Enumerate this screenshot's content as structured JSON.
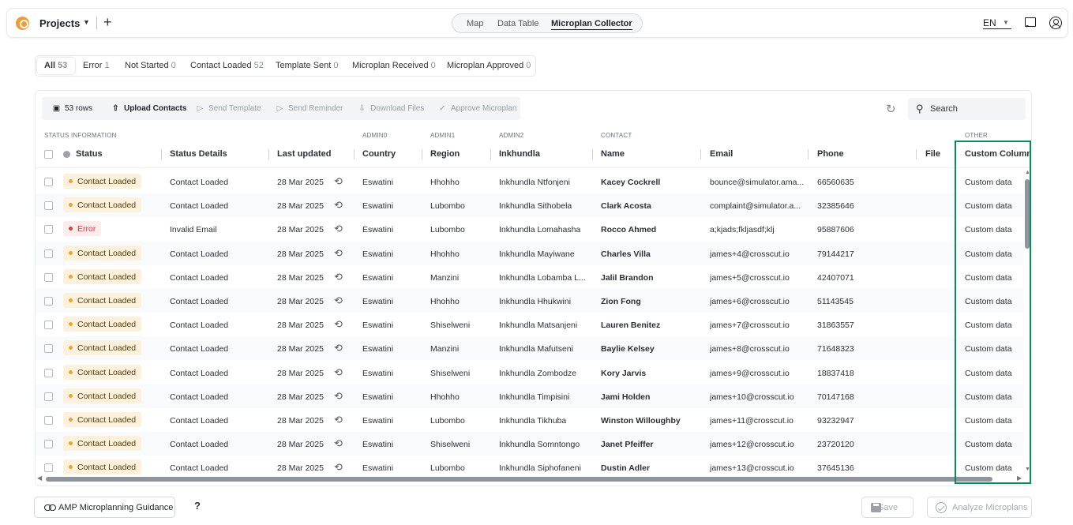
{
  "topbar": {
    "title": "Projects",
    "view_tabs": [
      "Map",
      "Data Table",
      "Microplan Collector"
    ],
    "active_tab": "Microplan Collector",
    "language": "EN"
  },
  "filters": [
    {
      "label": "All",
      "count": "53"
    },
    {
      "label": "Error",
      "count": "1"
    },
    {
      "label": "Not Started",
      "count": "0"
    },
    {
      "label": "Contact Loaded",
      "count": "52"
    },
    {
      "label": "Template Sent",
      "count": "0"
    },
    {
      "label": "Microplan Received",
      "count": "0"
    },
    {
      "label": "Microplan Approved",
      "count": "0"
    }
  ],
  "toolbar": {
    "rows_label": "53 rows",
    "upload": "Upload Contacts",
    "send_template": "Send Template",
    "send_reminder": "Send Reminder",
    "download_files": "Download Files",
    "approve_microplan": "Approve Microplan",
    "search_placeholder": "Search"
  },
  "groups": {
    "status": "STATUS INFORMATION",
    "admin0": "ADMIN0",
    "admin1": "ADMIN1",
    "admin2": "ADMIN2",
    "contact": "CONTACT",
    "other": "OTHER"
  },
  "columns": {
    "status": "Status",
    "status_details": "Status Details",
    "last_updated": "Last updated",
    "country": "Country",
    "region": "Region",
    "inkhundla": "Inkhundla",
    "name": "Name",
    "email": "Email",
    "phone": "Phone",
    "file": "File",
    "custom": "Custom Column"
  },
  "rows": [
    {
      "status": "Contact Loaded",
      "kind": "ok",
      "details": "Contact Loaded",
      "updated": "28 Mar 2025",
      "country": "Eswatini",
      "region": "Hhohho",
      "inkhundla": "Inkhundla Ntfonjeni",
      "name": "Kacey Cockrell",
      "email": "bounce@simulator.ama...",
      "phone": "66560635",
      "custom": "Custom data"
    },
    {
      "status": "Contact Loaded",
      "kind": "ok",
      "details": "Contact Loaded",
      "updated": "28 Mar 2025",
      "country": "Eswatini",
      "region": "Lubombo",
      "inkhundla": "Inkhundla Sithobela",
      "name": "Clark Acosta",
      "email": "complaint@simulator.a...",
      "phone": "32385646",
      "custom": "Custom data"
    },
    {
      "status": "Error",
      "kind": "err",
      "details": "Invalid Email",
      "updated": "28 Mar 2025",
      "country": "Eswatini",
      "region": "Lubombo",
      "inkhundla": "Inkhundla Lomahasha",
      "name": "Rocco Ahmed",
      "email": "a;kjads;fkljasdf;klj",
      "phone": "95887606",
      "custom": "Custom data"
    },
    {
      "status": "Contact Loaded",
      "kind": "ok",
      "details": "Contact Loaded",
      "updated": "28 Mar 2025",
      "country": "Eswatini",
      "region": "Hhohho",
      "inkhundla": "Inkhundla Mayiwane",
      "name": "Charles Villa",
      "email": "james+4@crosscut.io",
      "phone": "79144217",
      "custom": "Custom data"
    },
    {
      "status": "Contact Loaded",
      "kind": "ok",
      "details": "Contact Loaded",
      "updated": "28 Mar 2025",
      "country": "Eswatini",
      "region": "Manzini",
      "inkhundla": "Inkhundla Lobamba L...",
      "name": "Jalil Brandon",
      "email": "james+5@crosscut.io",
      "phone": "42407071",
      "custom": "Custom data"
    },
    {
      "status": "Contact Loaded",
      "kind": "ok",
      "details": "Contact Loaded",
      "updated": "28 Mar 2025",
      "country": "Eswatini",
      "region": "Hhohho",
      "inkhundla": "Inkhundla Hhukwini",
      "name": "Zion Fong",
      "email": "james+6@crosscut.io",
      "phone": "51143545",
      "custom": "Custom data"
    },
    {
      "status": "Contact Loaded",
      "kind": "ok",
      "details": "Contact Loaded",
      "updated": "28 Mar 2025",
      "country": "Eswatini",
      "region": "Shiselweni",
      "inkhundla": "Inkhundla Matsanjeni",
      "name": "Lauren Benitez",
      "email": "james+7@crosscut.io",
      "phone": "31863557",
      "custom": "Custom data"
    },
    {
      "status": "Contact Loaded",
      "kind": "ok",
      "details": "Contact Loaded",
      "updated": "28 Mar 2025",
      "country": "Eswatini",
      "region": "Manzini",
      "inkhundla": "Inkhundla Mafutseni",
      "name": "Baylie Kelsey",
      "email": "james+8@crosscut.io",
      "phone": "71648323",
      "custom": "Custom data"
    },
    {
      "status": "Contact Loaded",
      "kind": "ok",
      "details": "Contact Loaded",
      "updated": "28 Mar 2025",
      "country": "Eswatini",
      "region": "Shiselweni",
      "inkhundla": "Inkhundla Zombodze",
      "name": "Kory Jarvis",
      "email": "james+9@crosscut.io",
      "phone": "18837418",
      "custom": "Custom data"
    },
    {
      "status": "Contact Loaded",
      "kind": "ok",
      "details": "Contact Loaded",
      "updated": "28 Mar 2025",
      "country": "Eswatini",
      "region": "Hhohho",
      "inkhundla": "Inkhundla Timpisini",
      "name": "Jami Holden",
      "email": "james+10@crosscut.io",
      "phone": "70147168",
      "custom": "Custom data"
    },
    {
      "status": "Contact Loaded",
      "kind": "ok",
      "details": "Contact Loaded",
      "updated": "28 Mar 2025",
      "country": "Eswatini",
      "region": "Lubombo",
      "inkhundla": "Inkhundla Tikhuba",
      "name": "Winston Willoughby",
      "email": "james+11@crosscut.io",
      "phone": "93232947",
      "custom": "Custom data"
    },
    {
      "status": "Contact Loaded",
      "kind": "ok",
      "details": "Contact Loaded",
      "updated": "28 Mar 2025",
      "country": "Eswatini",
      "region": "Shiselweni",
      "inkhundla": "Inkhundla Somntongo",
      "name": "Janet Pfeiffer",
      "email": "james+12@crosscut.io",
      "phone": "23720120",
      "custom": "Custom data"
    },
    {
      "status": "Contact Loaded",
      "kind": "ok",
      "details": "Contact Loaded",
      "updated": "28 Mar 2025",
      "country": "Eswatini",
      "region": "Lubombo",
      "inkhundla": "Inkhundla Siphofaneni",
      "name": "Dustin Adler",
      "email": "james+13@crosscut.io",
      "phone": "37645136",
      "custom": "Custom data"
    }
  ],
  "footer": {
    "guidance": "AMP Microplanning Guidance",
    "help": "?",
    "save": "Save",
    "analyze": "Analyze Microplans"
  },
  "colors": {
    "highlight": "#0b8a5f",
    "contact_loaded_bg": "#fbf1dc",
    "error_bg": "#fdecec",
    "logo": "#f29a38"
  }
}
